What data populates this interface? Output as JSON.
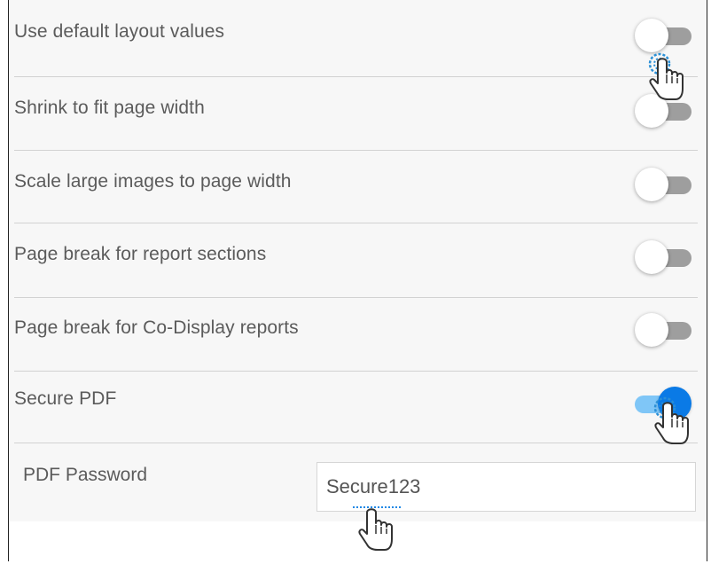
{
  "settings": {
    "rows": [
      {
        "label": "Use default layout values",
        "on": false
      },
      {
        "label": "Shrink to fit page width",
        "on": false
      },
      {
        "label": "Scale large images to page width",
        "on": false
      },
      {
        "label": "Page break for report sections",
        "on": false
      },
      {
        "label": "Page break for Co-Display reports",
        "on": false
      },
      {
        "label": "Secure PDF",
        "on": true
      }
    ],
    "password_label": "PDF Password",
    "password_value": "Secure123"
  },
  "colors": {
    "panel_bg": "#f7f7f7",
    "toggle_off_track": "#9e9e9e",
    "toggle_on_track": "#7fc6f7",
    "toggle_on_knob": "#0a7ae6"
  },
  "icons": [
    "hand-pointer-icon"
  ]
}
